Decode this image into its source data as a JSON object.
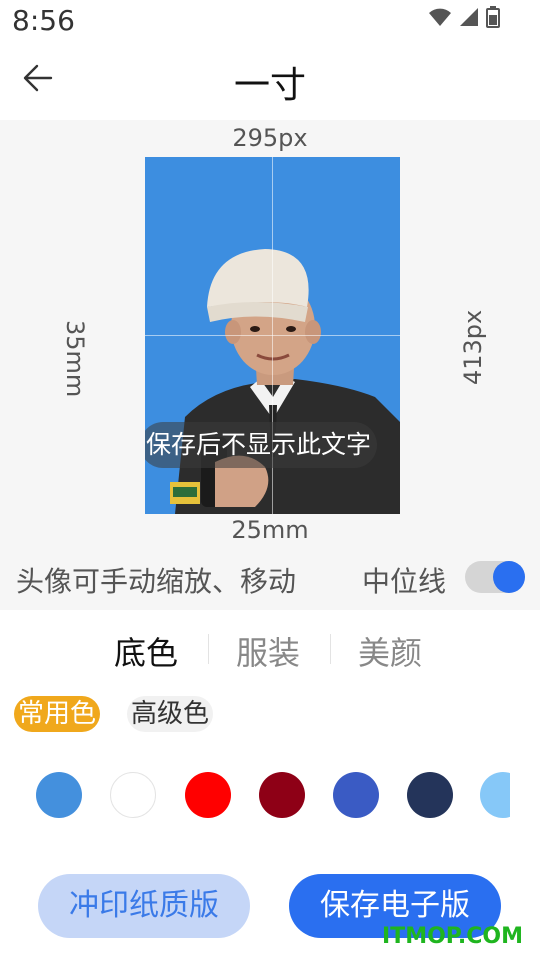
{
  "status_bar": {
    "time": "8:56",
    "icons": [
      "wifi-icon",
      "signal-icon",
      "battery-icon"
    ]
  },
  "header": {
    "title": "一寸",
    "back_icon": "arrow-left-icon"
  },
  "preview": {
    "width_px": "295px",
    "height_px": "413px",
    "height_mm": "35mm",
    "width_mm": "25mm",
    "notice": "保存后不显示此文字",
    "background_color": "#3d8ee0"
  },
  "controls": {
    "hint": "头像可手动缩放、移动",
    "midline_label": "中位线",
    "midline_on": true
  },
  "tabs": [
    {
      "label": "底色",
      "active": true
    },
    {
      "label": "服装",
      "active": false
    },
    {
      "label": "美颜",
      "active": false
    }
  ],
  "color_groups": [
    {
      "label": "常用色",
      "active": true
    },
    {
      "label": "高级色",
      "active": false
    }
  ],
  "swatches": [
    "#4490dd",
    "#ffffff",
    "#ff0000",
    "#8e0016",
    "#3a5bc4",
    "#24345a",
    "#86c8f8"
  ],
  "buttons": {
    "print": "冲印纸质版",
    "save": "保存电子版"
  },
  "watermark": "ITMOP.COM",
  "colors": {
    "accent": "#2a6ff0",
    "chip_active": "#f0a81c"
  }
}
